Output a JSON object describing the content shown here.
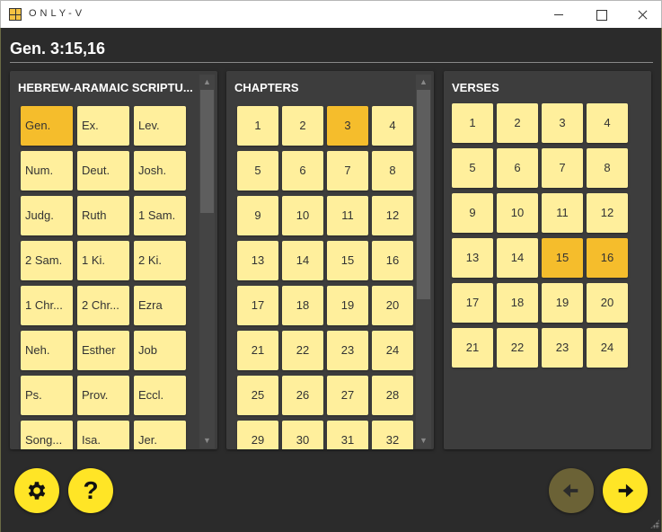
{
  "window": {
    "title": "ONLY-V"
  },
  "reference": "Gen. 3:15,16",
  "books": {
    "heading": "HEBREW-ARAMAIC SCRIPTU...",
    "items": [
      "Gen.",
      "Ex.",
      "Lev.",
      "Num.",
      "Deut.",
      "Josh.",
      "Judg.",
      "Ruth",
      "1 Sam.",
      "2 Sam.",
      "1 Ki.",
      "2 Ki.",
      "1 Chr...",
      "2 Chr...",
      "Ezra",
      "Neh.",
      "Esther",
      "Job",
      "Ps.",
      "Prov.",
      "Eccl.",
      "Song...",
      "Isa.",
      "Jer."
    ],
    "selected": "Gen."
  },
  "chapters": {
    "heading": "CHAPTERS",
    "items": [
      "1",
      "2",
      "3",
      "4",
      "5",
      "6",
      "7",
      "8",
      "9",
      "10",
      "11",
      "12",
      "13",
      "14",
      "15",
      "16",
      "17",
      "18",
      "19",
      "20",
      "21",
      "22",
      "23",
      "24",
      "25",
      "26",
      "27",
      "28",
      "29",
      "30",
      "31",
      "32"
    ],
    "selected": [
      "3"
    ]
  },
  "verses": {
    "heading": "VERSES",
    "items": [
      "1",
      "2",
      "3",
      "4",
      "5",
      "6",
      "7",
      "8",
      "9",
      "10",
      "11",
      "12",
      "13",
      "14",
      "15",
      "16",
      "17",
      "18",
      "19",
      "20",
      "21",
      "22",
      "23",
      "24"
    ],
    "selected": [
      "15",
      "16"
    ]
  },
  "buttons": {
    "settings_icon": "gear-icon",
    "help_label": "?",
    "back_icon": "arrow-left-icon",
    "next_icon": "arrow-right-icon",
    "back_enabled": false
  },
  "colors": {
    "tile": "#ffef9c",
    "tile_selected": "#f5bd2c",
    "accent_button": "#ffe526"
  }
}
